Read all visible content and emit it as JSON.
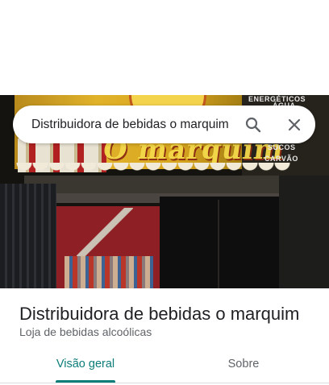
{
  "search": {
    "query": "Distribuidora de bebidas o marquim",
    "search_icon": "search-icon",
    "close_icon": "close-icon"
  },
  "photo": {
    "sign_text": "O marquim",
    "sign_words": [
      "ENERGÉTICOS",
      "ÁGUA",
      "SUCOS",
      "CARVÃO"
    ]
  },
  "place": {
    "title": "Distribuidora de bebidas o marquim",
    "category": "Loja de bebidas alcoólicas"
  },
  "tabs": [
    {
      "label": "Visão geral",
      "active": true
    },
    {
      "label": "Sobre",
      "active": false
    }
  ],
  "colors": {
    "accent": "#0b7d78",
    "title_text": "#202124",
    "secondary_text": "#5f6368"
  }
}
